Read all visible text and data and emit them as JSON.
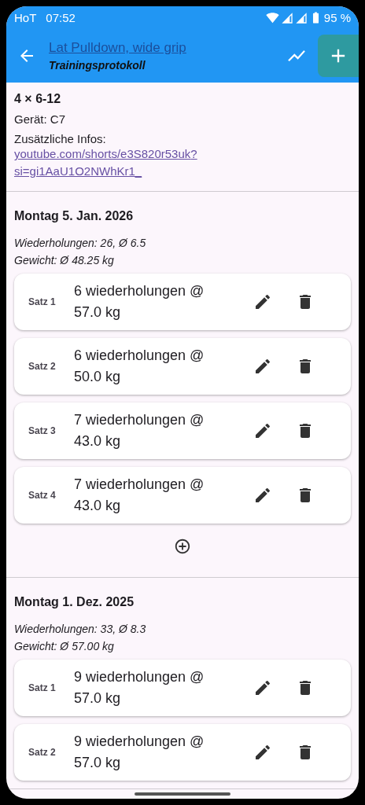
{
  "status_bar": {
    "carrier": "HoT",
    "time": "07:52",
    "battery": "95 %"
  },
  "app_bar": {
    "title": "Lat Pulldown, wide grip",
    "subtitle": "Trainingsprotokoll"
  },
  "exercise": {
    "scheme": "4 × 6-12",
    "device": "Gerät: C7",
    "info_label": "Zusätzliche Infos:",
    "link": "youtube.com/shorts/e3S820r53uk?si=gi1AaU1O2NWhKr1_"
  },
  "sessions": [
    {
      "date": "Montag 5. Jan. 2026",
      "reps": "Wiederholungen: 26, Ø 6.5",
      "weight": "Gewicht: Ø 48.25 kg",
      "add_button": true,
      "sets": [
        {
          "label": "Satz 1",
          "text": "6 wiederholungen @ 57.0 kg"
        },
        {
          "label": "Satz 2",
          "text": "6 wiederholungen @ 50.0 kg"
        },
        {
          "label": "Satz 3",
          "text": "7 wiederholungen @ 43.0 kg"
        },
        {
          "label": "Satz 4",
          "text": "7 wiederholungen @ 43.0 kg"
        }
      ]
    },
    {
      "date": "Montag 1. Dez. 2025",
      "reps": "Wiederholungen: 33, Ø 8.3",
      "weight": "Gewicht: Ø 57.00 kg",
      "sets": [
        {
          "label": "Satz 1",
          "text": "9 wiederholungen @ 57.0 kg"
        },
        {
          "label": "Satz 2",
          "text": "9 wiederholungen @ 57.0 kg"
        }
      ]
    }
  ]
}
